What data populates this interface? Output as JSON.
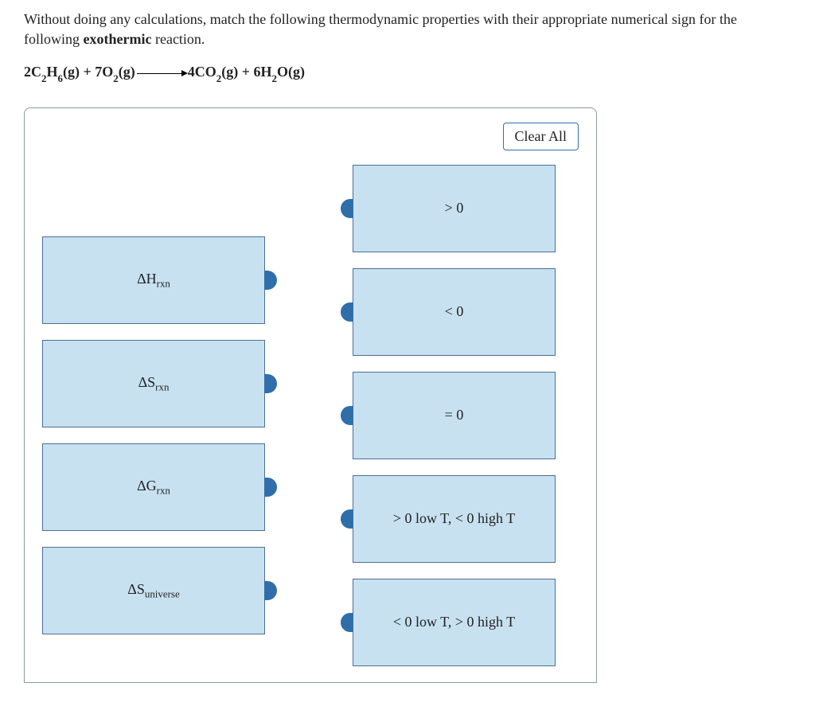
{
  "question": {
    "line1": "Without doing any calculations, match the following thermodynamic properties with their appropriate numerical sign for the following ",
    "bold_word": "exothermic",
    "line1_tail": " reaction."
  },
  "equation": {
    "r1_coef": "2C",
    "r1_sub1": "2",
    "r1_mid": "H",
    "r1_sub2": "6",
    "r1_phase": "(g)",
    "plus1": " + ",
    "r2_coef": "7O",
    "r2_sub": "2",
    "r2_phase": "(g)",
    "p1_coef": "4CO",
    "p1_sub": "2",
    "p1_phase": "(g)",
    "plus2": " + ",
    "p2_coef": "6H",
    "p2_sub": "2",
    "p2_tail": "O(g)"
  },
  "clear_label": "Clear All",
  "left_items": [
    {
      "delta": "Δ",
      "sym": "H",
      "sub": "rxn"
    },
    {
      "delta": "Δ",
      "sym": "S",
      "sub": "rxn"
    },
    {
      "delta": "Δ",
      "sym": "G",
      "sub": "rxn"
    },
    {
      "delta": "Δ",
      "sym": "S",
      "sub": "universe"
    }
  ],
  "right_items": [
    {
      "text": "> 0"
    },
    {
      "text": "< 0"
    },
    {
      "text": "= 0"
    },
    {
      "text": "> 0 low T, < 0 high T"
    },
    {
      "text": "< 0 low T, > 0 high T"
    }
  ]
}
